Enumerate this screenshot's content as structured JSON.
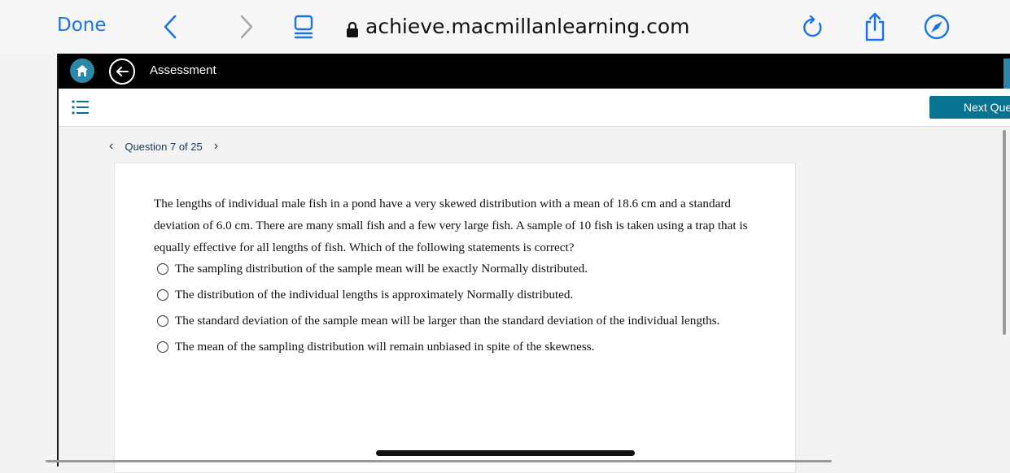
{
  "browser": {
    "done_label": "Done",
    "url": "achieve.macmillanlearning.com"
  },
  "app": {
    "title": "Assessment",
    "next_button": "Next Question"
  },
  "question_nav": {
    "label": "Question 7 of 25"
  },
  "question": {
    "text": "The lengths of individual male fish in a pond have a very skewed distribution with a mean of 18.6 cm and a standard deviation of 6.0 cm. There are many small fish and a few very large fish. A sample of 10 fish is taken using a trap that is equally effective for all lengths of fish. Which of the following statements is correct?",
    "options": [
      "The sampling distribution of the sample mean will be exactly Normally distributed.",
      "The distribution of the individual lengths is approximately Normally distributed.",
      "The standard deviation of the sample mean will be larger than the standard deviation of the individual lengths.",
      "The mean of the sampling distribution will remain unbiased in spite of the skewness."
    ]
  },
  "colors": {
    "accent": "#1a73e8",
    "brand_teal": "#087390",
    "home_teal": "#2b89a7"
  },
  "icons": [
    "back-chevron-icon",
    "forward-chevron-icon",
    "reader-icon",
    "lock-icon",
    "reload-icon",
    "share-icon",
    "compass-icon",
    "home-icon",
    "arrow-left-icon",
    "list-icon"
  ]
}
